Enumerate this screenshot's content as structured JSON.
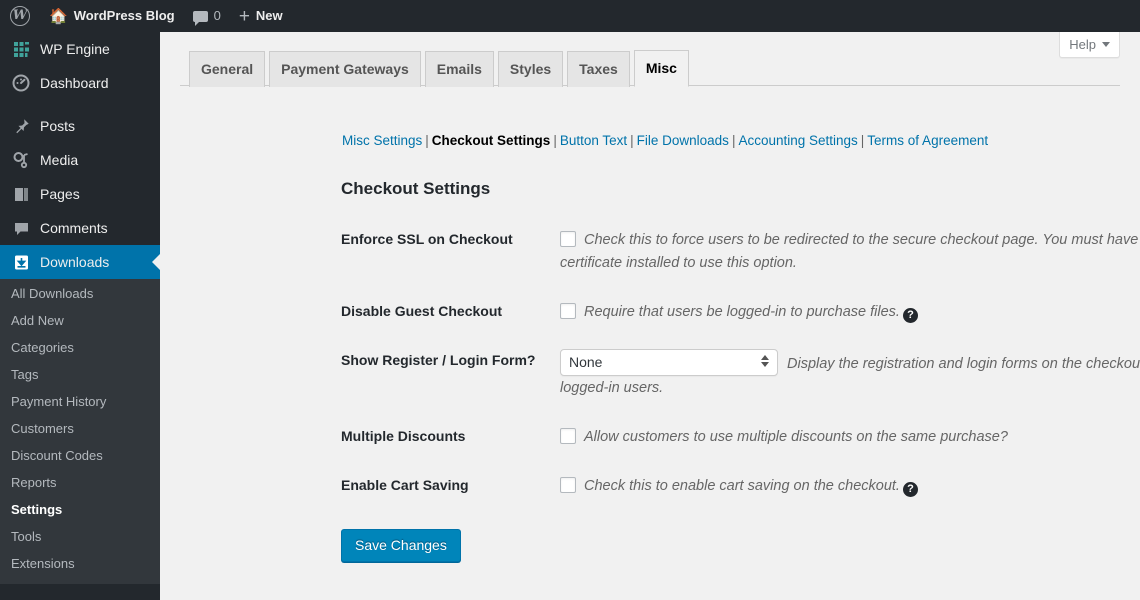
{
  "adminbar": {
    "wp_logo_icon": "wordpress-logo-icon",
    "site_home_icon": "home-icon",
    "site_name": "WordPress Blog",
    "comments_icon": "comment-bubble-icon",
    "comments_count": "0",
    "new_icon": "plus-icon",
    "new_label": "New"
  },
  "sidebar": {
    "top_items": [
      {
        "label": "WP Engine",
        "icon": "wpengine-grid-icon",
        "current": false
      },
      {
        "label": "Dashboard",
        "icon": "dashboard-gauge-icon",
        "current": false
      },
      {
        "label": "Posts",
        "icon": "pin-icon",
        "current": false
      },
      {
        "label": "Media",
        "icon": "media-icon",
        "current": false
      },
      {
        "label": "Pages",
        "icon": "pages-icon",
        "current": false
      },
      {
        "label": "Comments",
        "icon": "comment-bubble-icon",
        "current": false
      },
      {
        "label": "Downloads",
        "icon": "download-box-icon",
        "current": true
      }
    ],
    "submenu": [
      {
        "label": "All Downloads",
        "current": false
      },
      {
        "label": "Add New",
        "current": false
      },
      {
        "label": "Categories",
        "current": false
      },
      {
        "label": "Tags",
        "current": false
      },
      {
        "label": "Payment History",
        "current": false
      },
      {
        "label": "Customers",
        "current": false
      },
      {
        "label": "Discount Codes",
        "current": false
      },
      {
        "label": "Reports",
        "current": false
      },
      {
        "label": "Settings",
        "current": true
      },
      {
        "label": "Tools",
        "current": false
      },
      {
        "label": "Extensions",
        "current": false
      }
    ]
  },
  "help": {
    "label": "Help",
    "caret_icon": "chevron-down-icon"
  },
  "tabs": [
    {
      "label": "General",
      "active": false
    },
    {
      "label": "Payment Gateways",
      "active": false
    },
    {
      "label": "Emails",
      "active": false
    },
    {
      "label": "Styles",
      "active": false
    },
    {
      "label": "Taxes",
      "active": false
    },
    {
      "label": "Misc",
      "active": true
    }
  ],
  "subnav": [
    {
      "label": "Misc Settings",
      "current": false
    },
    {
      "label": "Checkout Settings",
      "current": true
    },
    {
      "label": "Button Text",
      "current": false
    },
    {
      "label": "File Downloads",
      "current": false
    },
    {
      "label": "Accounting Settings",
      "current": false
    },
    {
      "label": "Terms of Agreement",
      "current": false
    }
  ],
  "section_title": "Checkout Settings",
  "rows": [
    {
      "label": "Enforce SSL on Checkout",
      "type": "checkbox",
      "checked": false,
      "description": "Check this to force users to be redirected to the secure checkout page. You must have an SSL certificate installed to use this option.",
      "tooltip_icon": null
    },
    {
      "label": "Disable Guest Checkout",
      "type": "checkbox",
      "checked": false,
      "description": "Require that users be logged-in to purchase files.",
      "tooltip_icon": "help-question-icon"
    },
    {
      "label": "Show Register / Login Form?",
      "type": "select",
      "value": "None",
      "options": [
        "None"
      ],
      "description": "Display the registration and login forms on the checkout page for non-logged-in users.",
      "tooltip_icon": null
    },
    {
      "label": "Multiple Discounts",
      "type": "checkbox",
      "checked": false,
      "description": "Allow customers to use multiple discounts on the same purchase?",
      "tooltip_icon": null
    },
    {
      "label": "Enable Cart Saving",
      "type": "checkbox",
      "checked": false,
      "description": "Check this to enable cart saving on the checkout.",
      "tooltip_icon": "help-question-icon"
    }
  ],
  "submit": {
    "label": "Save Changes"
  },
  "colors": {
    "admin_bar": "#23282d",
    "sidebar": "#23282d",
    "submenu": "#32373c",
    "accent_blue": "#0073aa",
    "button_blue": "#0085ba",
    "link_blue": "#0073aa",
    "body_bg": "#f1f1f1",
    "wpengine_icon": "#40a39b"
  }
}
